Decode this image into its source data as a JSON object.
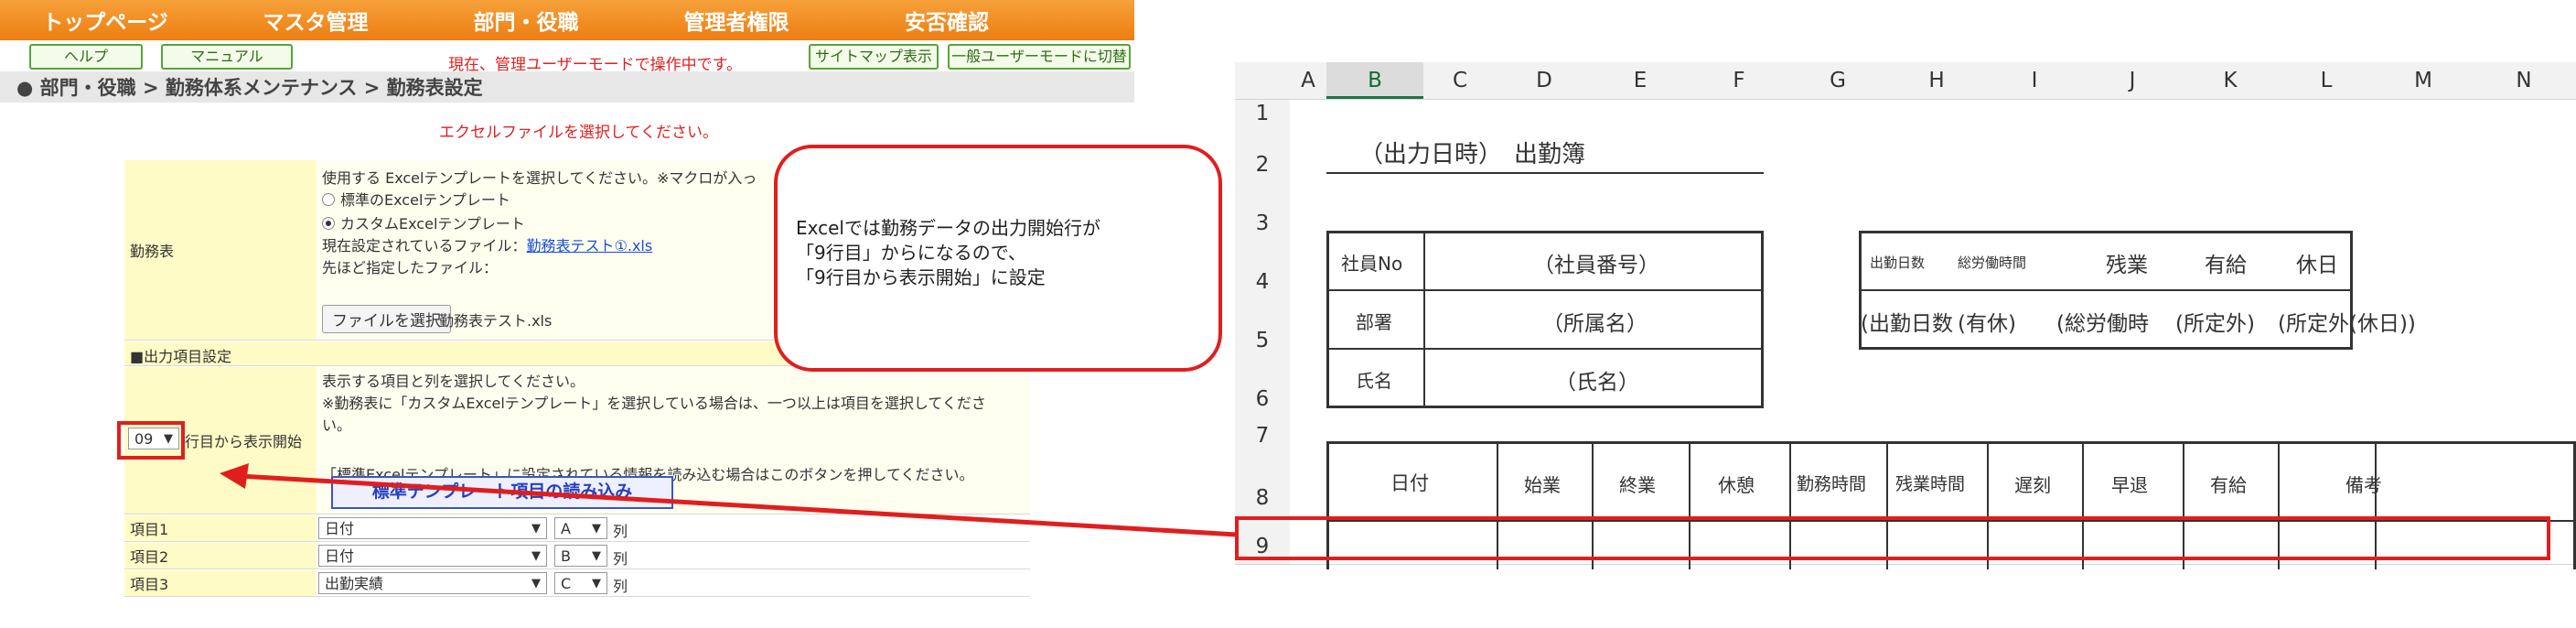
{
  "nav": {
    "items": [
      "トップページ",
      "マスタ管理",
      "部門・役職",
      "管理者権限",
      "安否確認"
    ]
  },
  "toolbar": {
    "help_label": "ヘルプ",
    "manual_label": "マニュアル",
    "mode_text": "現在、管理ユーザーモードで操作中です。",
    "sitemap_label": "サイトマップ表示",
    "switch_label": "一般ユーザーモードに切替"
  },
  "breadcrumb": "● 部門・役職 > 勤務体系メンテナンス > 勤務表設定",
  "notice": "エクセルファイルを選択してください。",
  "form": {
    "kinmuhyo_label": "勤務表",
    "template_instruction": "使用する Excelテンプレートを選択してください。※マクロが入っ",
    "radio_standard": "標準のExcelテンプレート",
    "radio_custom": "カスタムExcelテンプレート",
    "current_file_label": "現在設定されているファイル：",
    "current_file_link": "勤務表テスト①.xls",
    "prev_file_label": "先ほど指定したファイル：",
    "file_button": "ファイルを選択",
    "file_name": "勤務表テスト.xls",
    "output_section": "■出力項目設定",
    "start_row_value": "09",
    "start_row_label": "行目から表示開始",
    "item_instruction_1": "表示する項目と列を選択してください。",
    "item_instruction_2": "※勤務表に「カスタムExcelテンプレート」を選択している場合は、一つ以上は項目を選択してくださ",
    "item_instruction_3": "い。",
    "item_instruction_4": "「標準Excelテンプレート」に設定されている情報を読み込む場合はこのボタンを押してください。",
    "std_button": "標準テンプレート項目の読み込み",
    "items": [
      {
        "label": "項目1",
        "field": "日付",
        "col": "A",
        "suffix": "列"
      },
      {
        "label": "項目2",
        "field": "日付",
        "col": "B",
        "suffix": "列"
      },
      {
        "label": "項目3",
        "field": "出勤実績",
        "col": "C",
        "suffix": "列"
      }
    ]
  },
  "callout": {
    "line1": "Excelでは勤務データの出力開始行が",
    "line2": "「9行目」からになるので、",
    "line3": "「9行目から表示開始」に設定"
  },
  "sheet": {
    "columns": [
      "A",
      "B",
      "C",
      "D",
      "E",
      "F",
      "G",
      "H",
      "I",
      "J",
      "K",
      "L",
      "M",
      "N"
    ],
    "rows": [
      "1",
      "2",
      "3",
      "4",
      "5",
      "6",
      "7",
      "8",
      "9"
    ],
    "title": "（出力日時）　出勤簿",
    "emp_no_label": "社員No",
    "emp_no_value": "（社員番号）",
    "dept_label": "部署",
    "dept_value": "（所属名）",
    "name_label": "氏名",
    "name_value": "（氏名）",
    "summary_headers": [
      "出勤日数",
      "総労働時間",
      "残業",
      "有給",
      "休日"
    ],
    "summary_values": [
      "(出勤日数",
      "(有休)",
      "(総労働時",
      "(所定外)",
      "(所定外(休日))"
    ],
    "table_headers": [
      "日付",
      "始業",
      "終業",
      "休憩",
      "勤務時間",
      "残業時間",
      "遅刻",
      "早退",
      "有給",
      "備考"
    ]
  }
}
